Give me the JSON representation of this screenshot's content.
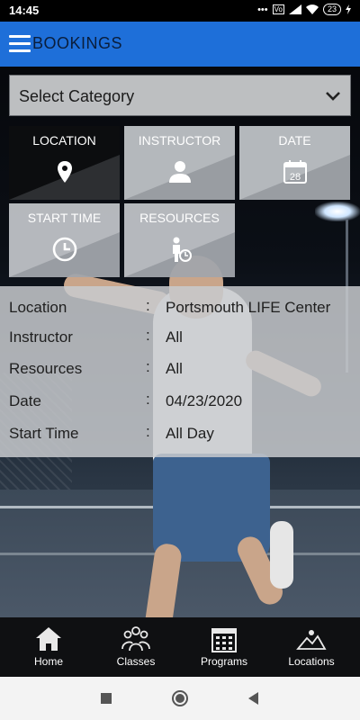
{
  "status_bar": {
    "time": "14:45",
    "dots": "•••",
    "vo": "Vo",
    "battery": "23"
  },
  "app_bar": {
    "title": "BOOKINGS"
  },
  "category_select": {
    "label": "Select Category"
  },
  "tiles": [
    {
      "label": "LOCATION",
      "icon": "location-pin-icon"
    },
    {
      "label": "INSTRUCTOR",
      "icon": "person-icon"
    },
    {
      "label": "DATE",
      "icon": "calendar-icon",
      "day": "28"
    },
    {
      "label": "START TIME",
      "icon": "clock-icon"
    },
    {
      "label": "RESOURCES",
      "icon": "resource-person-icon"
    }
  ],
  "details": {
    "colon": ":",
    "rows": [
      {
        "label": "Location",
        "value": "Portsmouth LIFE Center"
      },
      {
        "label": "Instructor",
        "value": "All"
      },
      {
        "label": "Resources",
        "value": "All"
      },
      {
        "label": "Date",
        "value": "04/23/2020"
      },
      {
        "label": "Start Time",
        "value": "All Day"
      }
    ]
  },
  "bottom_nav": [
    {
      "label": "Home",
      "icon": "home-icon"
    },
    {
      "label": "Classes",
      "icon": "group-icon"
    },
    {
      "label": "Programs",
      "icon": "calendar-grid-icon"
    },
    {
      "label": "Locations",
      "icon": "map-terrain-icon"
    }
  ],
  "colors": {
    "app_bar": "#1E6FD9",
    "title_text": "#0A1E3C",
    "nav_bg": "#0f1012"
  }
}
